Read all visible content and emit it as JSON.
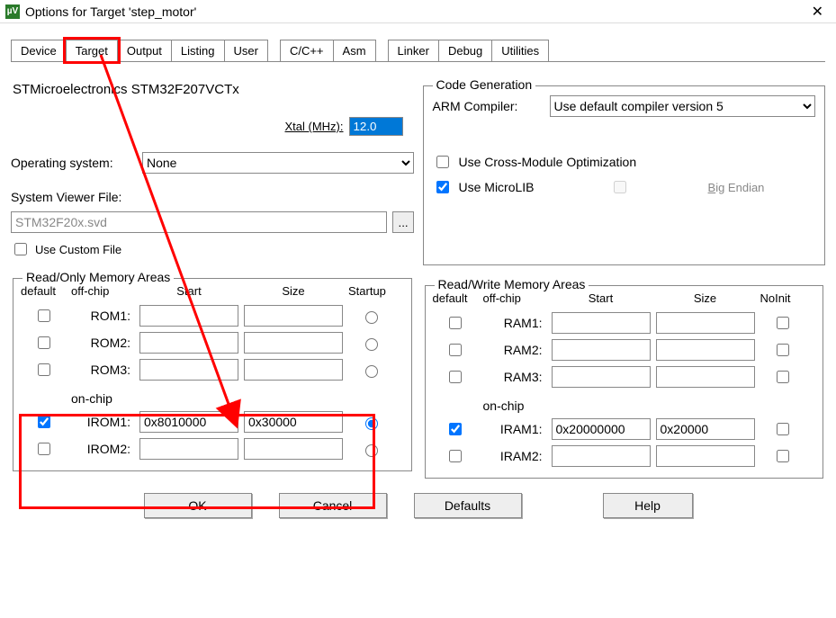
{
  "window": {
    "title": "Options for Target 'step_motor'",
    "icon_text": "µV"
  },
  "tabs": [
    "Device",
    "Target",
    "Output",
    "Listing",
    "User",
    "C/C++",
    "Asm",
    "Linker",
    "Debug",
    "Utilities"
  ],
  "active_tab": 1,
  "device": {
    "name": "STMicroelectronics STM32F207VCTx"
  },
  "xtal": {
    "label": "Xtal (MHz):",
    "value": "12.0"
  },
  "os": {
    "label": "Operating system:",
    "value": "None"
  },
  "sv": {
    "label": "System Viewer File:",
    "value": "STM32F20x.svd",
    "browse": "..."
  },
  "custom": {
    "label": "Use Custom File"
  },
  "code_gen": {
    "legend": "Code Generation",
    "compiler_label": "ARM Compiler:",
    "compiler_value": "Use default compiler version 5",
    "cross_label": "Use Cross-Module Optimization",
    "microlib_label": "Use MicroLIB",
    "bigendian_label": "Big Endian"
  },
  "readonly": {
    "legend": "Read/Only Memory Areas",
    "headers": {
      "default": "default",
      "offchip": "off-chip",
      "start": "Start",
      "size": "Size",
      "startup": "Startup",
      "onchip": "on-chip"
    },
    "rows_off": [
      {
        "label": "ROM1:",
        "start": "",
        "size": ""
      },
      {
        "label": "ROM2:",
        "start": "",
        "size": ""
      },
      {
        "label": "ROM3:",
        "start": "",
        "size": ""
      }
    ],
    "rows_on": [
      {
        "label": "IROM1:",
        "start": "0x8010000",
        "size": "0x30000",
        "default": true,
        "startup": true
      },
      {
        "label": "IROM2:",
        "start": "",
        "size": ""
      }
    ]
  },
  "readwrite": {
    "legend": "Read/Write Memory Areas",
    "headers": {
      "default": "default",
      "offchip": "off-chip",
      "start": "Start",
      "size": "Size",
      "noinit": "NoInit",
      "onchip": "on-chip"
    },
    "rows_off": [
      {
        "label": "RAM1:",
        "start": "",
        "size": ""
      },
      {
        "label": "RAM2:",
        "start": "",
        "size": ""
      },
      {
        "label": "RAM3:",
        "start": "",
        "size": ""
      }
    ],
    "rows_on": [
      {
        "label": "IRAM1:",
        "start": "0x20000000",
        "size": "0x20000",
        "default": true
      },
      {
        "label": "IRAM2:",
        "start": "",
        "size": ""
      }
    ]
  },
  "buttons": {
    "ok": "OK",
    "cancel": "Cancel",
    "defaults": "Defaults",
    "help": "Help"
  }
}
